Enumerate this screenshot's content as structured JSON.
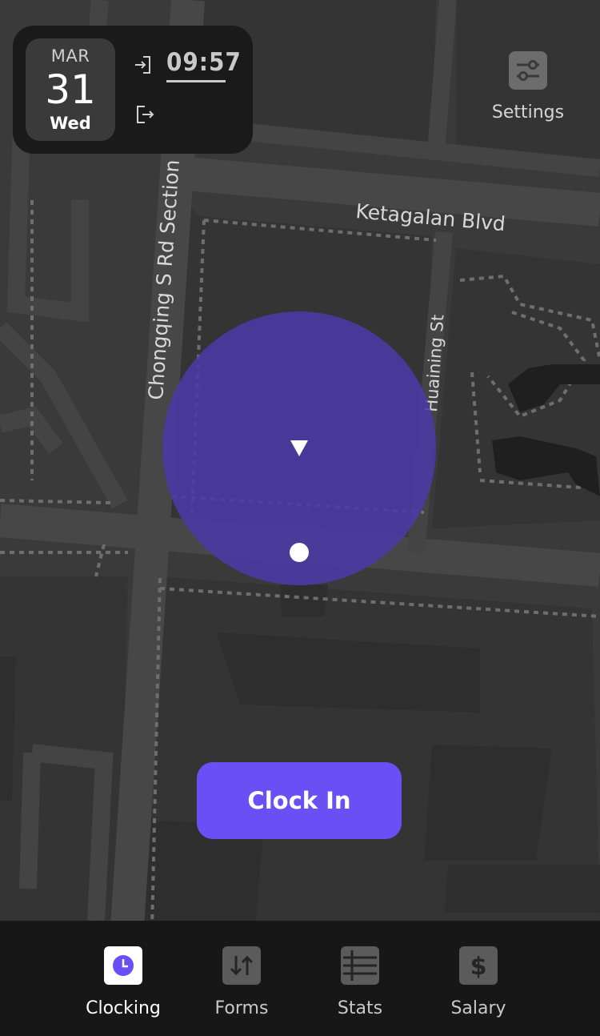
{
  "map": {
    "street_labels": [
      "Ketagalan Blvd",
      "Chongqing S Rd Section",
      "Huaining St"
    ],
    "geofence_color": "#4a3a9a",
    "location_marker_color": "#ffffff",
    "heading_marker_icon": "direction-arrow-icon"
  },
  "date_card": {
    "month": "MAR",
    "day": "31",
    "weekday": "Wed",
    "clock_in_icon": "login-icon",
    "clock_in_time": "09:57",
    "clock_out_icon": "logout-icon"
  },
  "settings": {
    "label": "Settings",
    "icon": "sliders-icon"
  },
  "action": {
    "clock_in_label": "Clock In",
    "color": "#6a4ff5"
  },
  "tabbar": {
    "tabs": [
      {
        "label": "Clocking",
        "icon": "clock-icon",
        "active": true
      },
      {
        "label": "Forms",
        "icon": "swap-arrows-icon",
        "active": false
      },
      {
        "label": "Stats",
        "icon": "list-icon",
        "active": false
      },
      {
        "label": "Salary",
        "icon": "dollar-icon",
        "active": false
      }
    ]
  }
}
